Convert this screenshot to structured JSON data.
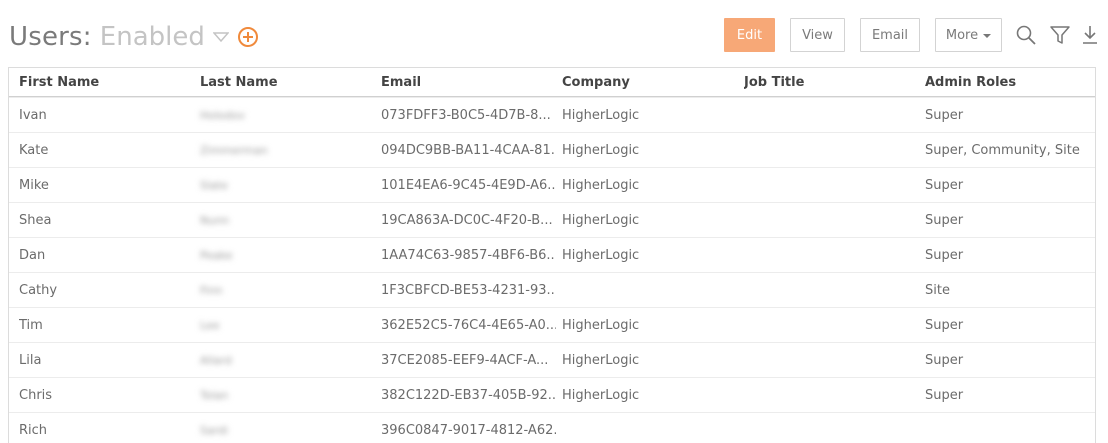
{
  "header": {
    "title": "Users:",
    "filter": "Enabled"
  },
  "toolbar": {
    "edit_label": "Edit",
    "view_label": "View",
    "email_label": "Email",
    "more_label": "More"
  },
  "colors": {
    "accent": "#f7a877",
    "add_icon": "#f08a3c"
  },
  "icons": [
    "chevron-down-icon",
    "add-circle-icon",
    "caret-down-icon",
    "search-icon",
    "filter-icon",
    "download-icon"
  ],
  "table": {
    "columns": [
      "First Name",
      "Last Name",
      "Email",
      "Company",
      "Job Title",
      "Admin Roles"
    ],
    "rows": [
      {
        "first": "Ivan",
        "last": "Holodov",
        "email": "073FDFF3-B0C5-4D7B-8...",
        "company": "HigherLogic",
        "job": "",
        "roles": "Super"
      },
      {
        "first": "Kate",
        "last": "Zimmerman",
        "email": "094DC9BB-BA11-4CAA-81...",
        "company": "HigherLogic",
        "job": "",
        "roles": "Super, Community, Site"
      },
      {
        "first": "Mike",
        "last": "Slate",
        "email": "101E4EA6-9C45-4E9D-A6...",
        "company": "HigherLogic",
        "job": "",
        "roles": "Super"
      },
      {
        "first": "Shea",
        "last": "Nunn",
        "email": "19CA863A-DC0C-4F20-B...",
        "company": "HigherLogic",
        "job": "",
        "roles": "Super"
      },
      {
        "first": "Dan",
        "last": "Peake",
        "email": "1AA74C63-9857-4BF6-B6...",
        "company": "HigherLogic",
        "job": "",
        "roles": "Super"
      },
      {
        "first": "Cathy",
        "last": "Finn",
        "email": "1F3CBFCD-BE53-4231-93...",
        "company": "",
        "job": "",
        "roles": "Site"
      },
      {
        "first": "Tim",
        "last": "Lee",
        "email": "362E52C5-76C4-4E65-A0...",
        "company": "HigherLogic",
        "job": "",
        "roles": "Super"
      },
      {
        "first": "Lila",
        "last": "Allard",
        "email": "37CE2085-EEF9-4ACF-A...",
        "company": "HigherLogic",
        "job": "",
        "roles": "Super"
      },
      {
        "first": "Chris",
        "last": "Tolan",
        "email": "382C122D-EB37-405B-92...",
        "company": "HigherLogic",
        "job": "",
        "roles": "Super"
      },
      {
        "first": "Rich",
        "last": "Sardi",
        "email": "396C0847-9017-4812-A62...",
        "company": "",
        "job": "",
        "roles": ""
      }
    ]
  }
}
